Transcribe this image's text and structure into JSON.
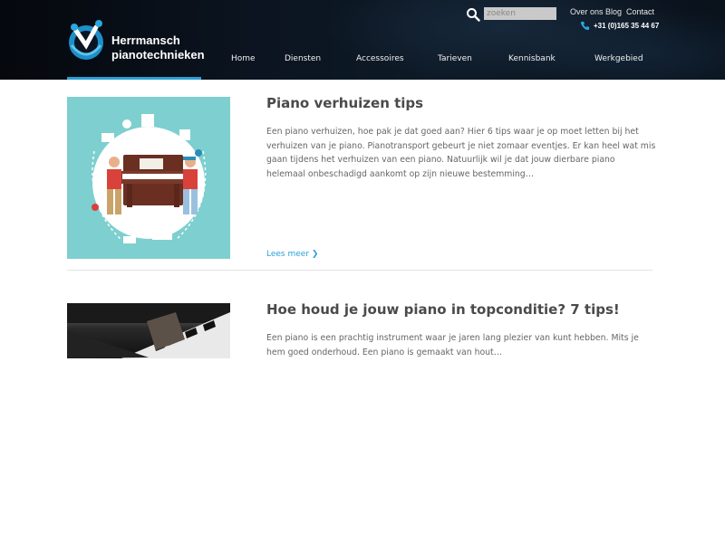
{
  "brand": {
    "name_line1": "Herrmansch",
    "name_line2": "pianotechnieken",
    "accent": "#2a9fd6"
  },
  "search": {
    "placeholder": "zoeken",
    "icon": "search-icon"
  },
  "toplinks": [
    "Over ons",
    "Blog",
    "Contact"
  ],
  "phone": {
    "number": "+31 (0)165 35 44 67",
    "icon": "phone-icon"
  },
  "nav": [
    "Home",
    "Diensten",
    "Accessoires",
    "Tarieven",
    "Kennisbank",
    "Werkgebied"
  ],
  "articles": [
    {
      "title": "Piano verhuizen tips",
      "excerpt": "Een piano verhuizen, hoe pak je dat goed aan? Hier 6 tips waar je op moet letten bij het verhuizen van je piano. Pianotransport gebeurt je niet zomaar eventjes. Er kan heel wat mis gaan tijdens het verhuizen van een piano. Natuurlijk wil je dat jouw dierbare piano helemaal onbeschadigd aankomt op zijn nieuwe bestemming…",
      "read_more": "Lees meer"
    },
    {
      "title": "Hoe houd je jouw piano in topconditie? 7 tips!",
      "excerpt": "Een piano is een prachtig instrument waar je jaren lang plezier van kunt hebben. Mits je hem goed onderhoud. Een piano is gemaakt van hout…"
    }
  ]
}
